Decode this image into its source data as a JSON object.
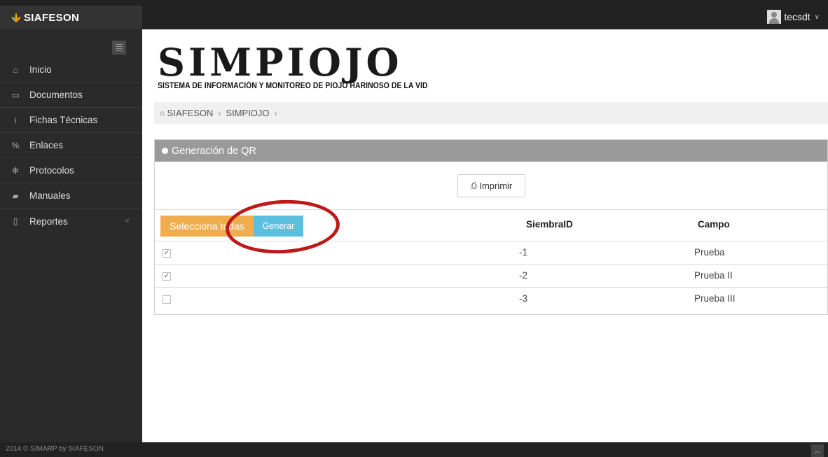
{
  "brand": {
    "name": "SIAFESON"
  },
  "user": {
    "name": "tecsdt"
  },
  "sidebar": {
    "items": [
      {
        "label": "Inicio",
        "icon": "home-icon",
        "glyph": "⌂"
      },
      {
        "label": "Documentos",
        "icon": "folder-icon",
        "glyph": "▭"
      },
      {
        "label": "Fichas Técnicas",
        "icon": "info-icon",
        "glyph": "i"
      },
      {
        "label": "Enlaces",
        "icon": "link-icon",
        "glyph": "%"
      },
      {
        "label": "Protocolos",
        "icon": "gear-icon",
        "glyph": "✻"
      },
      {
        "label": "Manuales",
        "icon": "book-icon",
        "glyph": "▰"
      },
      {
        "label": "Reportes",
        "icon": "file-icon",
        "glyph": "▯",
        "chevron": "<"
      }
    ]
  },
  "header": {
    "title": "SIMPIOJO",
    "subtitle": "SISTEMA DE INFORMACIÓN Y MONITOREO DE PIOJO HARINOSO DE LA VID"
  },
  "breadcrumb": {
    "items": [
      "SIAFESON",
      "SIMPIOJO"
    ],
    "separator": "›"
  },
  "panel": {
    "title": "Generación de QR",
    "print_label": "Imprimir",
    "select_all_label": "Selecciona todas",
    "generate_label": "Generar",
    "columns": [
      "SiembraID",
      "Campo"
    ],
    "rows": [
      {
        "checked": true,
        "siembra_id": "-1",
        "campo": "Prueba"
      },
      {
        "checked": true,
        "siembra_id": "-2",
        "campo": "Prueba II"
      },
      {
        "checked": false,
        "siembra_id": "-3",
        "campo": "Prueba III"
      }
    ]
  },
  "footer": {
    "text": "2014 © SIMARP by SIAFESON"
  },
  "colors": {
    "navbar": "#222222",
    "sidebar": "#2a2a2a",
    "panel_header": "#9a9a9a",
    "select_button": "#f0ad4e",
    "generate_button": "#5bc0de",
    "annotation": "#c01818"
  }
}
